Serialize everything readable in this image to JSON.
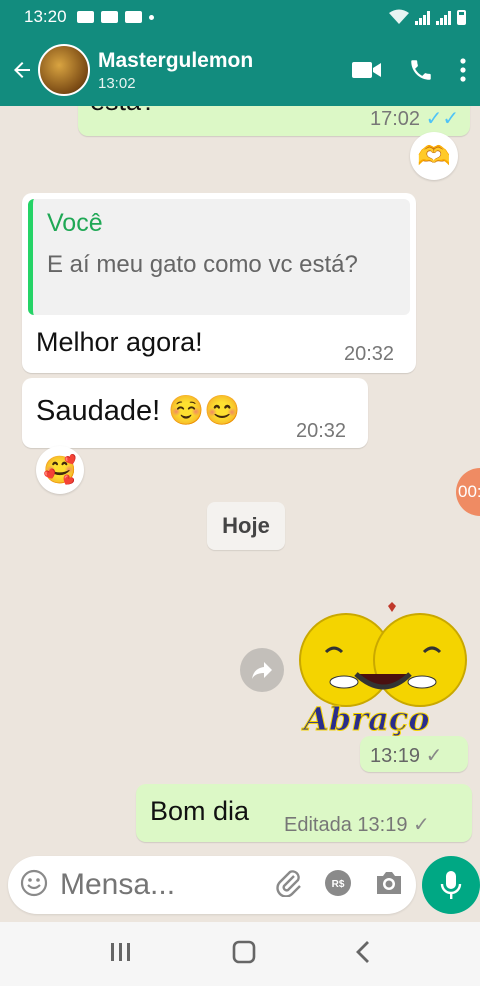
{
  "status_bar": {
    "time": "13:20"
  },
  "header": {
    "contact_name": "Mastergulemon",
    "contact_status": "13:02",
    "video_icon": "video-call-icon",
    "call_icon": "phone-icon",
    "menu_icon": "more-vert-icon"
  },
  "messages": {
    "top_partial": {
      "text": "está?",
      "time": "17:02",
      "reaction": "🫶"
    },
    "reply": {
      "quote_author": "Você",
      "quote_text": "E aí meu gato como vc está?",
      "text": "Melhor agora!",
      "time": "20:32"
    },
    "saudade": {
      "text": "Saudade! ☺️😊",
      "time": "20:32",
      "reaction": "🥰"
    },
    "edge_badge": "00:",
    "date_chip": "Hoje",
    "sticker": {
      "label": "Abraço",
      "time": "13:19"
    },
    "bom_dia": {
      "text": "Bom dia",
      "edited_label": "Editada",
      "time": "13:19"
    }
  },
  "composer": {
    "placeholder": "Mensa..."
  },
  "colors": {
    "header": "#128c7e",
    "outgoing": "#dcf8c6",
    "accent": "#25d366",
    "mic": "#00a884"
  }
}
